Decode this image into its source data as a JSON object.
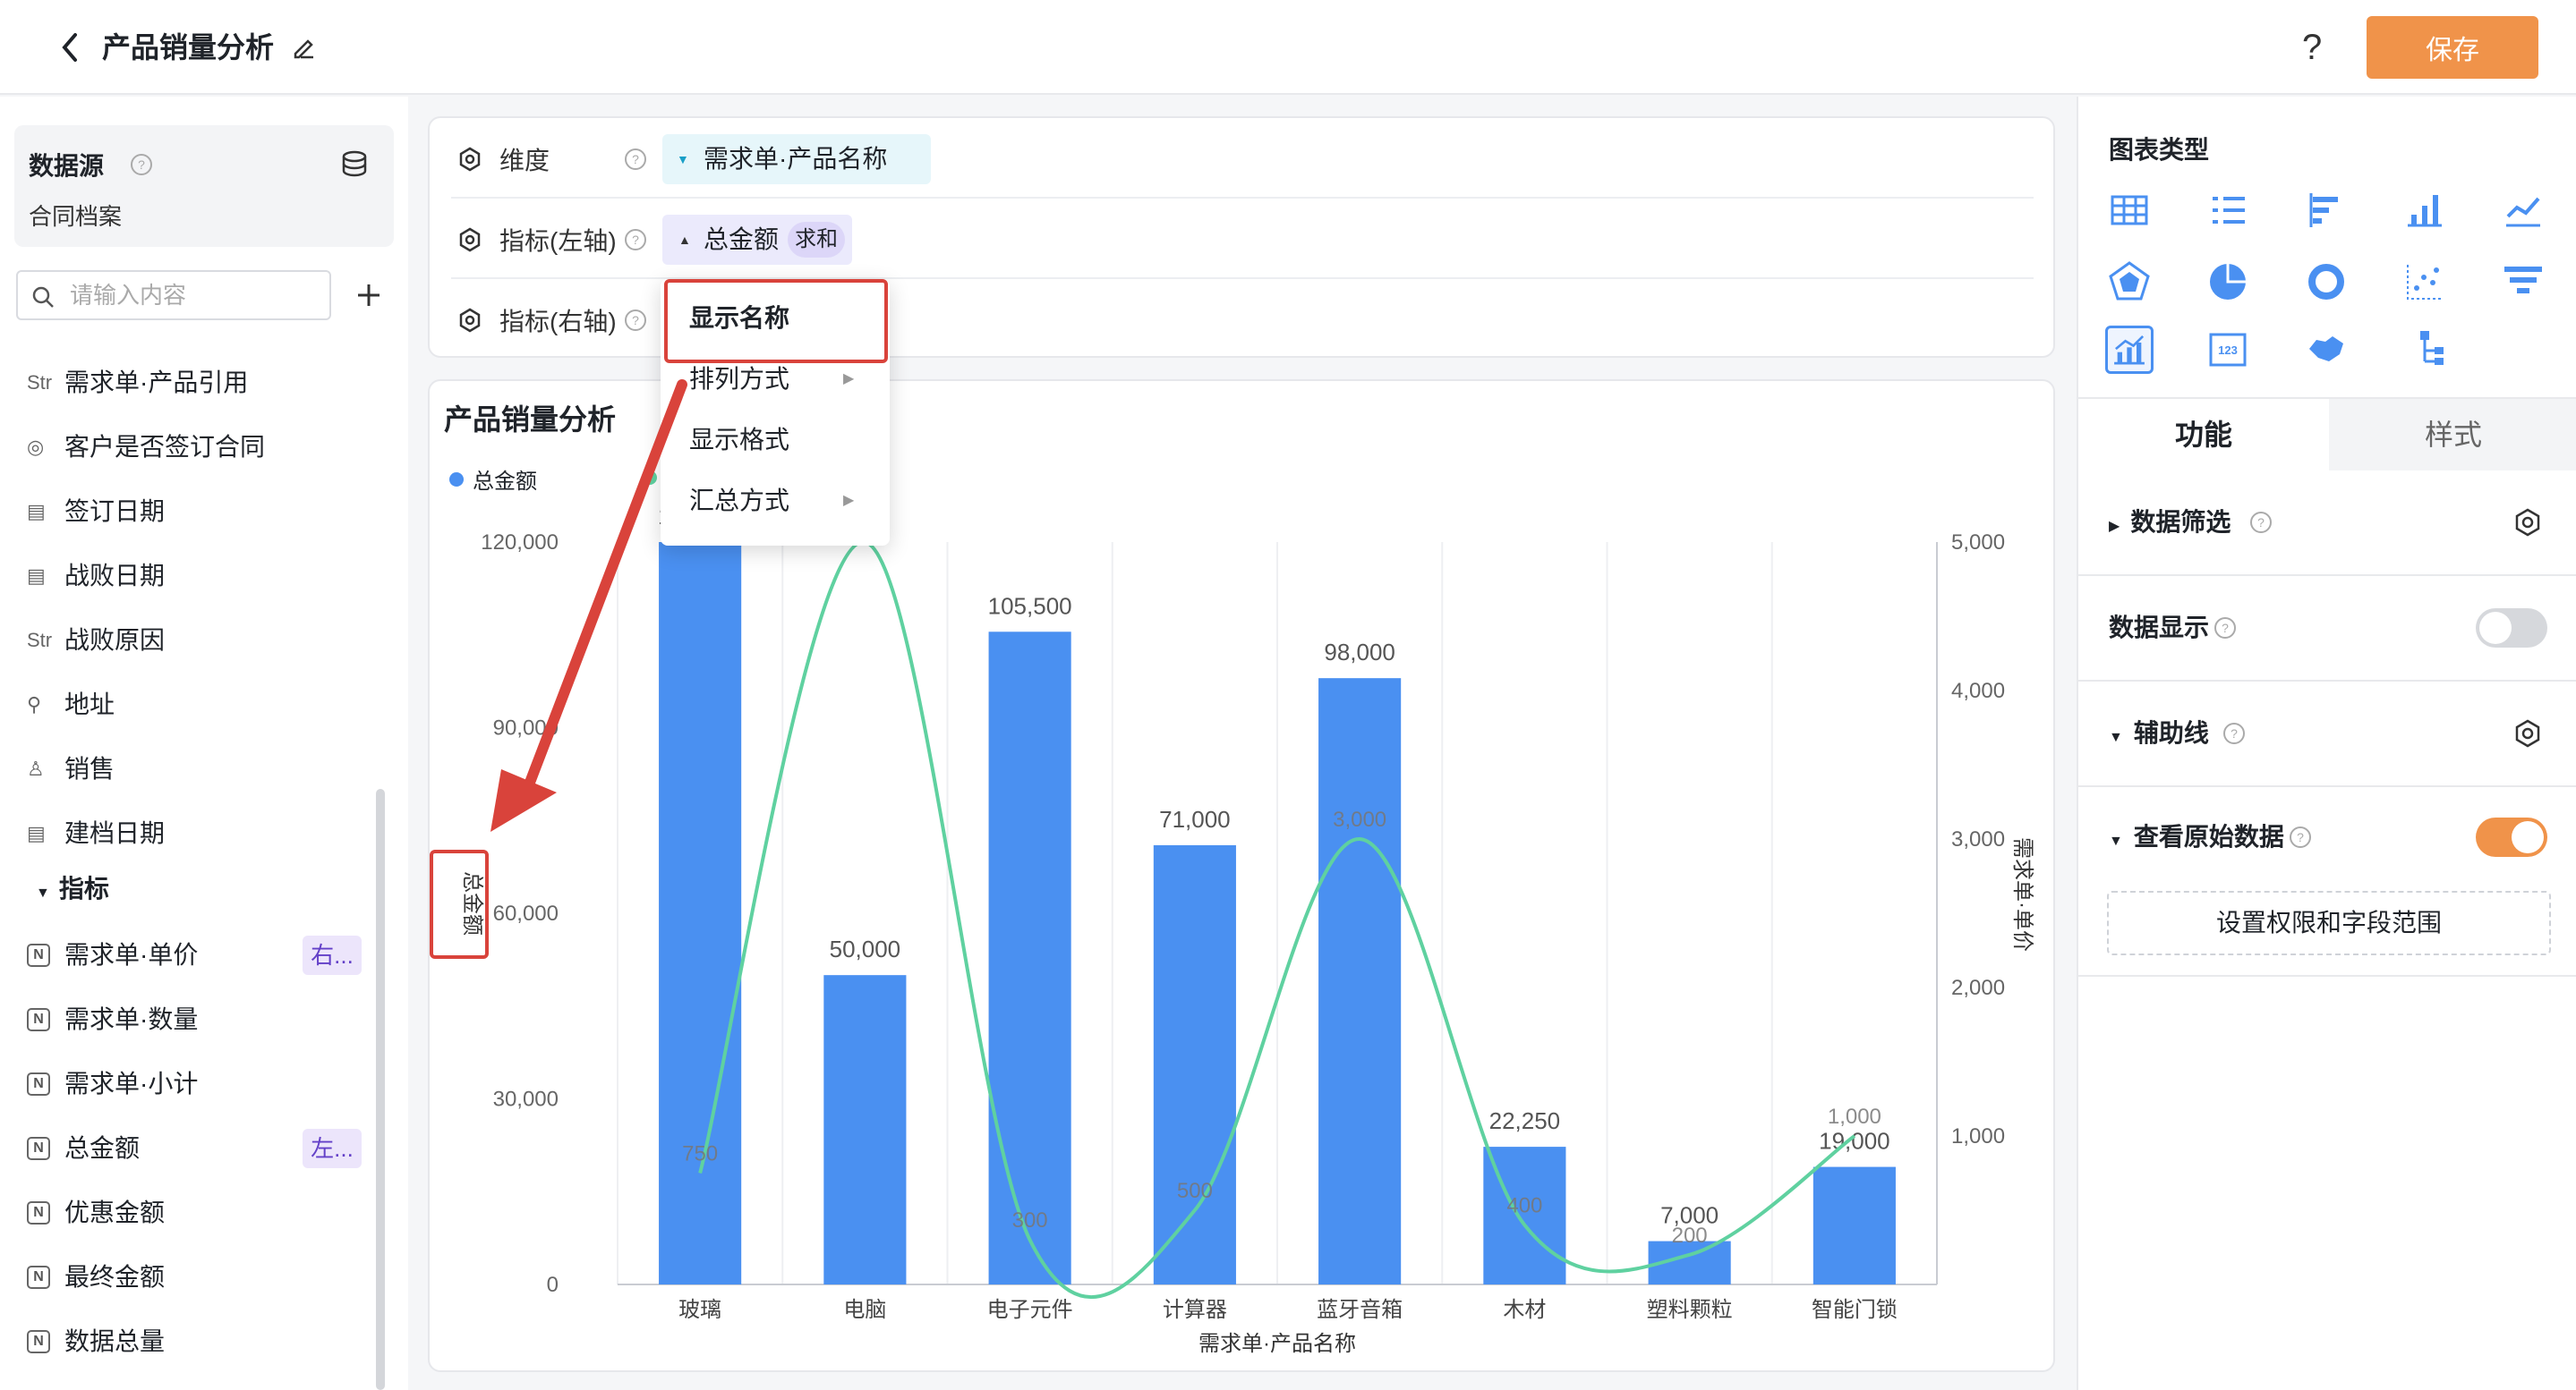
{
  "header": {
    "title": "产品销量分析",
    "help": "?",
    "save_label": "保存"
  },
  "sidebar": {
    "datasource_label": "数据源",
    "datasource_name": "合同档案",
    "search_placeholder": "请输入内容",
    "fields": [
      {
        "icon": "Str",
        "label": "需求单·产品引用"
      },
      {
        "icon": "◎",
        "label": "客户是否签订合同"
      },
      {
        "icon": "▤",
        "label": "签订日期"
      },
      {
        "icon": "▤",
        "label": "战败日期"
      },
      {
        "icon": "Str",
        "label": "战败原因"
      },
      {
        "icon": "⚲",
        "label": "地址"
      },
      {
        "icon": "♙",
        "label": "销售"
      },
      {
        "icon": "▤",
        "label": "建档日期"
      }
    ],
    "metrics_group": "指标",
    "metrics": [
      {
        "label": "需求单·单价",
        "badge": "右..."
      },
      {
        "label": "需求单·数量",
        "badge": ""
      },
      {
        "label": "需求单·小计",
        "badge": ""
      },
      {
        "label": "总金额",
        "badge": "左..."
      },
      {
        "label": "优惠金额",
        "badge": ""
      },
      {
        "label": "最终金额",
        "badge": ""
      },
      {
        "label": "数据总量",
        "badge": ""
      }
    ]
  },
  "config": {
    "dimension_label": "维度",
    "dimension_value": "需求单·产品名称",
    "left_axis_label": "指标(左轴)",
    "left_axis_value": "总金额",
    "left_axis_agg": "求和",
    "right_axis_label": "指标(右轴)"
  },
  "menu": {
    "items": [
      "显示名称",
      "排列方式",
      "显示格式",
      "汇总方式"
    ]
  },
  "chart_card": {
    "title": "产品销量分析"
  },
  "chart_data": {
    "type": "bar",
    "title": "产品销量分析",
    "categories": [
      "玻璃",
      "电脑",
      "电子元件",
      "计算器",
      "蓝牙音箱",
      "木材",
      "塑料颗粒",
      "智能门锁"
    ],
    "series": [
      {
        "name": "总金额",
        "type": "bar",
        "axis": "left",
        "color": "#4a90f1",
        "values": [
          120000,
          50000,
          105500,
          71000,
          98000,
          22250,
          7000,
          19000
        ],
        "labels": [
          "120,000",
          "50,000",
          "105,500",
          "71,000",
          "98,000",
          "22,250",
          "7,000",
          "19,000"
        ]
      },
      {
        "type": "line",
        "axis": "right",
        "color": "#5fd1a0",
        "smooth": true,
        "values": [
          750,
          5000,
          300,
          500,
          3000,
          400,
          200,
          1000
        ],
        "labels": [
          "750",
          "",
          "300",
          "500",
          "3,000",
          "400",
          "200",
          "1,000"
        ]
      }
    ],
    "xlabel": "需求单·产品名称",
    "ylabel": "总金额",
    "y2label": "需求单·单价",
    "ylim": [
      0,
      120000
    ],
    "y2lim": [
      0,
      5000
    ],
    "yticks": [
      "0",
      "30,000",
      "60,000",
      "90,000",
      "120,000"
    ],
    "y2ticks": [
      "1,000",
      "2,000",
      "3,000",
      "4,000",
      "5,000"
    ],
    "grid": "vertical",
    "legend": "top-left"
  },
  "right_panel": {
    "chart_type_label": "图表类型",
    "tab_function": "功能",
    "tab_style": "样式",
    "filter_label": "数据筛选",
    "data_display_label": "数据显示",
    "aux_line_label": "辅助线",
    "raw_data_label": "查看原始数据",
    "perm_button": "设置权限和字段范围"
  },
  "colors": {
    "accent": "#f0934a",
    "bar": "#4a90f1",
    "line": "#5fd1a0",
    "highlight": "#d9433b"
  }
}
